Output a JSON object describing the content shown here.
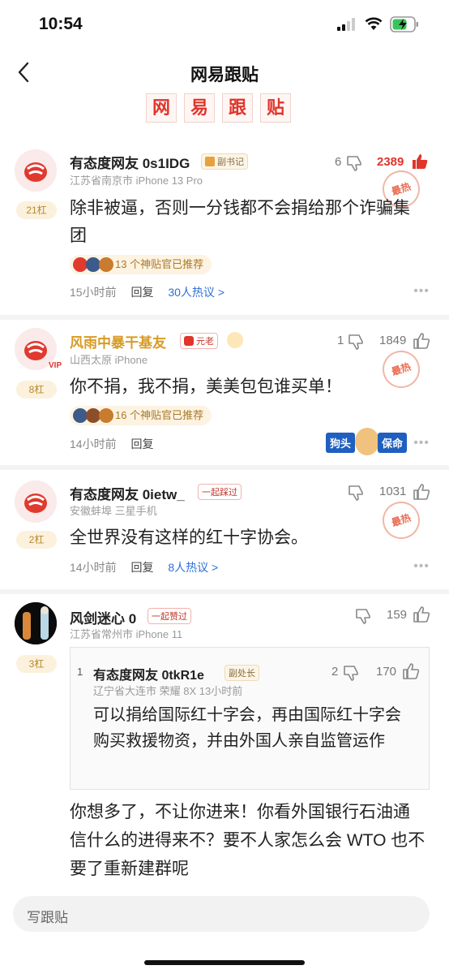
{
  "status": {
    "time": "10:54"
  },
  "nav": {
    "title": "网易跟贴"
  },
  "banner": [
    "网",
    "易",
    "跟",
    "贴"
  ],
  "comments": [
    {
      "name": "有态度网友 0s1IDG",
      "rank": "副书记",
      "meta": "江苏省南京市  iPhone 13 Pro",
      "floor": "21杠",
      "text": "除非被逼，否则一分钱都不会捐给那个诈骗集团",
      "rec": "13 个神贴官已推荐",
      "time": "15小时前",
      "reply": "回复",
      "hot": "30人热议 >",
      "dislikes": "6",
      "likes": "2389",
      "stamp": "最热"
    },
    {
      "name": "风雨中暴干基友",
      "rank": "元老",
      "meta": "山西太原  iPhone",
      "floor": "8杠",
      "text": "你不捐，我不捐，美美包包谁买单！",
      "rec": "16 个神贴官已推荐",
      "time": "14小时前",
      "reply": "回复",
      "dislikes": "1",
      "likes": "1849",
      "stamp": "最热",
      "vip": "VIP",
      "doge_left": "狗头",
      "doge_right": "保命"
    },
    {
      "name": "有态度网友 0ietw_",
      "rank": "一起踩过",
      "meta": "安徽蚌埠  三星手机",
      "floor": "2杠",
      "text": "全世界没有这样的红十字协会。",
      "time": "14小时前",
      "reply": "回复",
      "hot": "8人热议 >",
      "likes": "1031",
      "stamp": "最热"
    },
    {
      "name": "风剑迷心 0",
      "rank": "一起赞过",
      "meta": "江苏省常州市  iPhone 11",
      "floor": "3杠",
      "likes": "159",
      "quote": {
        "index": "1",
        "name": "有态度网友 0tkR1e",
        "rank": "副处长",
        "meta": "辽宁省大连市  荣耀 8X   13小时前",
        "text": "可以捐给国际红十字会，再由国际红十字会购买救援物资，并由外国人亲自监管运作",
        "dislikes": "2",
        "likes": "170"
      },
      "text": "你想多了，不让你进来！你看外国银行石油通信什么的进得来不？要不人家怎么会 WTO 也不要了重新建群呢"
    }
  ],
  "input": {
    "placeholder": "写跟贴"
  },
  "colors": {
    "accent": "#e0352b",
    "gold": "#d89b25",
    "link": "#2f6fd6"
  }
}
